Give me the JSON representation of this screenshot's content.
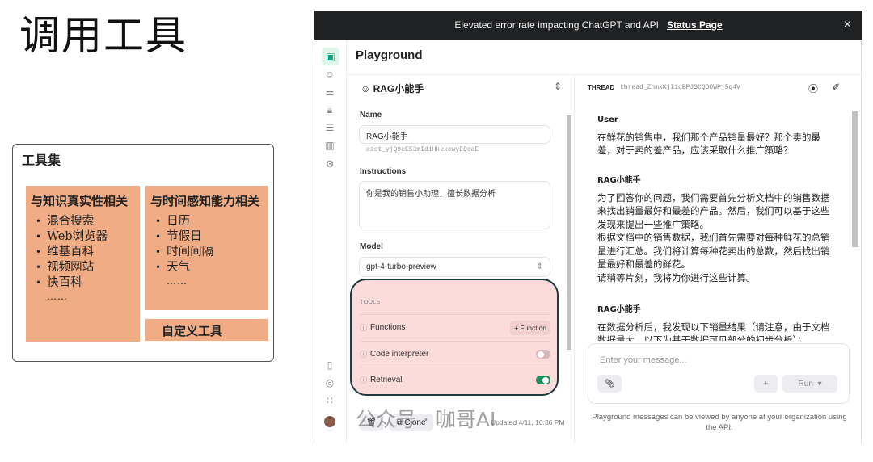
{
  "slide": {
    "title": "调用工具",
    "toolset_title": "工具集",
    "knowledge": {
      "heading": "与知识真实性相关",
      "items": [
        "混合搜索",
        "Web浏览器",
        "维基百科",
        "视频网站",
        "快百科"
      ],
      "more": "……"
    },
    "time": {
      "heading": "与时间感知能力相关",
      "items": [
        "日历",
        "节假日",
        "时间间隔",
        "天气"
      ],
      "more": "……"
    },
    "custom": "自定义工具"
  },
  "banner": {
    "text": "Elevated error rate impacting ChatGPT and API",
    "link": "Status Page",
    "close": "×"
  },
  "page_title": "Playground",
  "assistant": {
    "name": "RAG小能手",
    "name_label": "Name",
    "name_value": "RAG小能手",
    "id": "asst_yjQ9cE53mId1HkexowyEQcaE",
    "instructions_label": "Instructions",
    "instructions": "你是我的销售小助理，擅长数据分析",
    "model_label": "Model",
    "model": "gpt-4-turbo-preview",
    "tools_label": "TOOLS",
    "tools": [
      {
        "name": "Functions",
        "action": "+ Function"
      },
      {
        "name": "Code interpreter",
        "enabled": false
      },
      {
        "name": "Retrieval",
        "enabled": true
      }
    ],
    "clone": "Clone",
    "updated": "Updated 4/11, 10:36 PM"
  },
  "thread": {
    "label": "THREAD",
    "id": "thread_ZnmxKjI1qBPJSCQOOWPj5g4V",
    "messages": [
      {
        "who": "User",
        "text": "在鲜花的销售中，我们那个产品销量最好？那个卖的最差，对于卖的差产品，应该采取什么推广策略？"
      },
      {
        "who": "RAG小能手",
        "text": "为了回答你的问题，我们需要首先分析文档中的销售数据来找出销量最好和最差的产品。然后，我们可以基于这些发现来提出一些推广策略。\n根据文档中的销售数据，我们首先需要对每种鲜花的总销量进行汇总。我们将计算每种花卖出的总数，然后找出销量最好和最差的鲜花。\n请稍等片刻，我将为你进行这些计算。"
      },
      {
        "who": "RAG小能手",
        "text": "在数据分析后，我发现以下销量结果（请注意，由于文档数据量大，以下为基于数据可见部分的初步分析）："
      }
    ],
    "placeholder": "Enter your message...",
    "run": "Run",
    "add": "+",
    "footer": "Playground messages can be viewed by anyone at your organization using the API."
  },
  "watermark": "公众号 · 咖哥AI",
  "colors": {
    "orange": "#f0ad85",
    "tools_bg": "#fbdcda",
    "toggle_on": "#1e8a5b",
    "banner": "#202123"
  }
}
